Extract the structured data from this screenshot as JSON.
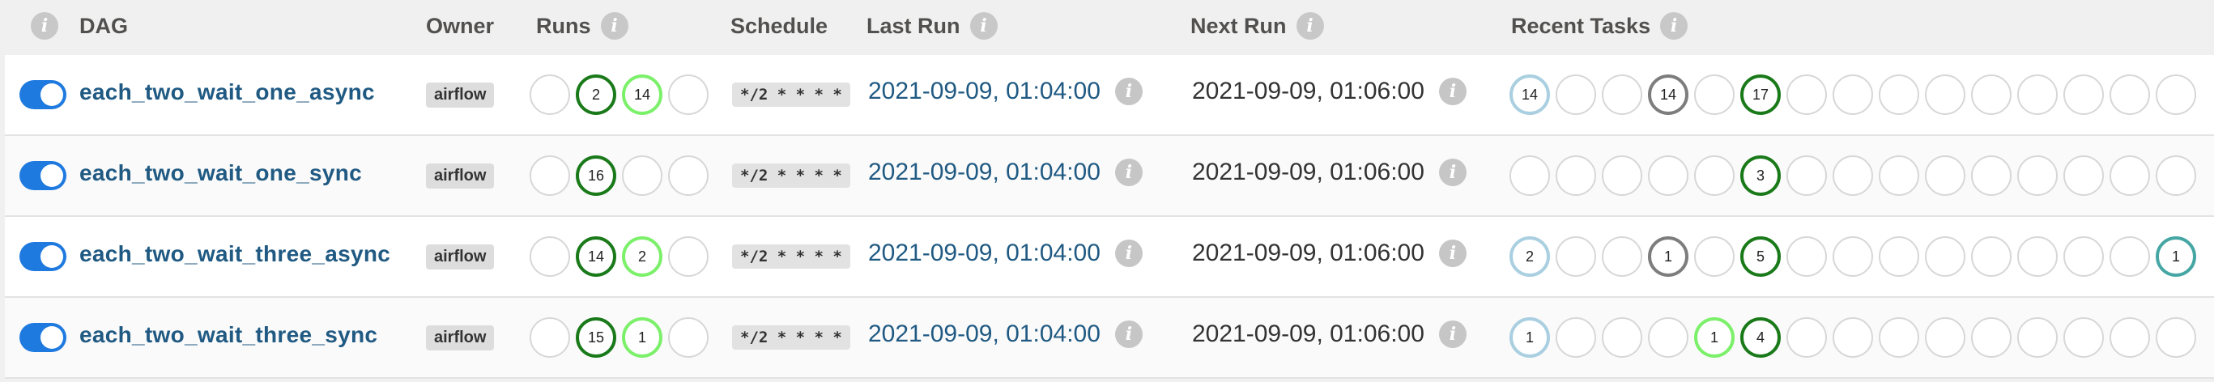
{
  "header": {
    "dag": "DAG",
    "owner": "Owner",
    "runs": "Runs",
    "schedule": "Schedule",
    "last_run": "Last Run",
    "next_run": "Next Run",
    "recent_tasks": "Recent Tasks",
    "info_glyph": "i"
  },
  "rows": [
    {
      "paused": false,
      "dag_id": "each_two_wait_one_async",
      "owner": "airflow",
      "runs": [
        {
          "state": "none",
          "count": ""
        },
        {
          "state": "success",
          "count": "2"
        },
        {
          "state": "running",
          "count": "14"
        },
        {
          "state": "none",
          "count": ""
        }
      ],
      "schedule": "*/2 * * * *",
      "last_run": "2021-09-09, 01:04:00",
      "next_run": "2021-09-09, 01:06:00",
      "tasks": [
        {
          "state": "queued",
          "count": "14"
        },
        {
          "state": "none",
          "count": ""
        },
        {
          "state": "none",
          "count": ""
        },
        {
          "state": "upstream_failed",
          "count": "14"
        },
        {
          "state": "none",
          "count": ""
        },
        {
          "state": "success",
          "count": "17"
        },
        {
          "state": "none",
          "count": ""
        },
        {
          "state": "none",
          "count": ""
        },
        {
          "state": "none",
          "count": ""
        },
        {
          "state": "none",
          "count": ""
        },
        {
          "state": "none",
          "count": ""
        },
        {
          "state": "none",
          "count": ""
        },
        {
          "state": "none",
          "count": ""
        },
        {
          "state": "none",
          "count": ""
        },
        {
          "state": "none",
          "count": ""
        }
      ]
    },
    {
      "paused": false,
      "dag_id": "each_two_wait_one_sync",
      "owner": "airflow",
      "runs": [
        {
          "state": "none",
          "count": ""
        },
        {
          "state": "success",
          "count": "16"
        },
        {
          "state": "none",
          "count": ""
        },
        {
          "state": "none",
          "count": ""
        }
      ],
      "schedule": "*/2 * * * *",
      "last_run": "2021-09-09, 01:04:00",
      "next_run": "2021-09-09, 01:06:00",
      "tasks": [
        {
          "state": "none",
          "count": ""
        },
        {
          "state": "none",
          "count": ""
        },
        {
          "state": "none",
          "count": ""
        },
        {
          "state": "none",
          "count": ""
        },
        {
          "state": "none",
          "count": ""
        },
        {
          "state": "success",
          "count": "3"
        },
        {
          "state": "none",
          "count": ""
        },
        {
          "state": "none",
          "count": ""
        },
        {
          "state": "none",
          "count": ""
        },
        {
          "state": "none",
          "count": ""
        },
        {
          "state": "none",
          "count": ""
        },
        {
          "state": "none",
          "count": ""
        },
        {
          "state": "none",
          "count": ""
        },
        {
          "state": "none",
          "count": ""
        },
        {
          "state": "none",
          "count": ""
        }
      ]
    },
    {
      "paused": false,
      "dag_id": "each_two_wait_three_async",
      "owner": "airflow",
      "runs": [
        {
          "state": "none",
          "count": ""
        },
        {
          "state": "success",
          "count": "14"
        },
        {
          "state": "running",
          "count": "2"
        },
        {
          "state": "none",
          "count": ""
        }
      ],
      "schedule": "*/2 * * * *",
      "last_run": "2021-09-09, 01:04:00",
      "next_run": "2021-09-09, 01:06:00",
      "tasks": [
        {
          "state": "queued",
          "count": "2"
        },
        {
          "state": "none",
          "count": ""
        },
        {
          "state": "none",
          "count": ""
        },
        {
          "state": "upstream_failed",
          "count": "1"
        },
        {
          "state": "none",
          "count": ""
        },
        {
          "state": "success",
          "count": "5"
        },
        {
          "state": "none",
          "count": ""
        },
        {
          "state": "none",
          "count": ""
        },
        {
          "state": "none",
          "count": ""
        },
        {
          "state": "none",
          "count": ""
        },
        {
          "state": "none",
          "count": ""
        },
        {
          "state": "none",
          "count": ""
        },
        {
          "state": "none",
          "count": ""
        },
        {
          "state": "none",
          "count": ""
        },
        {
          "state": "scheduled",
          "count": "1"
        }
      ]
    },
    {
      "paused": false,
      "dag_id": "each_two_wait_three_sync",
      "owner": "airflow",
      "runs": [
        {
          "state": "none",
          "count": ""
        },
        {
          "state": "success",
          "count": "15"
        },
        {
          "state": "running",
          "count": "1"
        },
        {
          "state": "none",
          "count": ""
        }
      ],
      "schedule": "*/2 * * * *",
      "last_run": "2021-09-09, 01:04:00",
      "next_run": "2021-09-09, 01:06:00",
      "tasks": [
        {
          "state": "queued",
          "count": "1"
        },
        {
          "state": "none",
          "count": ""
        },
        {
          "state": "none",
          "count": ""
        },
        {
          "state": "none",
          "count": ""
        },
        {
          "state": "running",
          "count": "1"
        },
        {
          "state": "success",
          "count": "4"
        },
        {
          "state": "none",
          "count": ""
        },
        {
          "state": "none",
          "count": ""
        },
        {
          "state": "none",
          "count": ""
        },
        {
          "state": "none",
          "count": ""
        },
        {
          "state": "none",
          "count": ""
        },
        {
          "state": "none",
          "count": ""
        },
        {
          "state": "none",
          "count": ""
        },
        {
          "state": "none",
          "count": ""
        },
        {
          "state": "none",
          "count": ""
        }
      ]
    }
  ]
}
